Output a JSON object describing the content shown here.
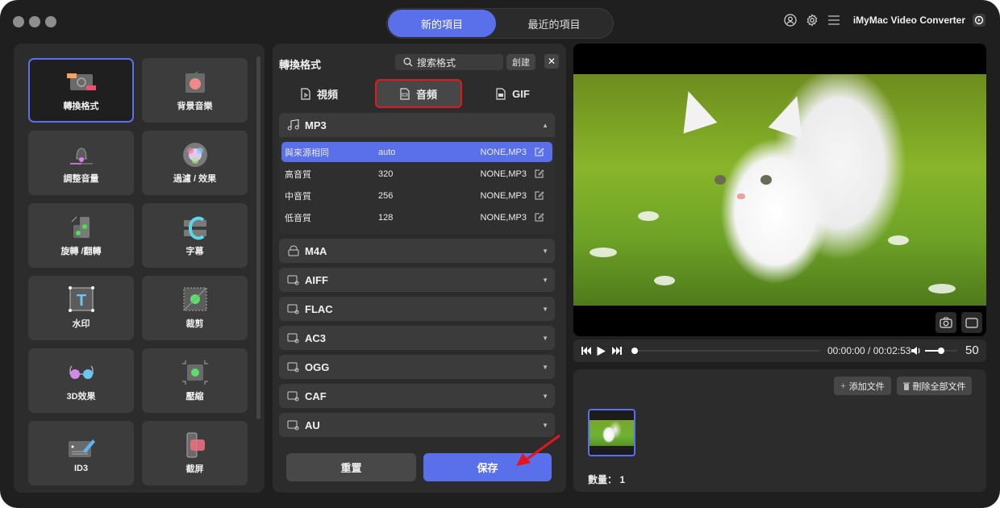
{
  "header": {
    "tabs": [
      {
        "label": "新的項目",
        "active": true
      },
      {
        "label": "最近的項目",
        "active": false
      }
    ],
    "icons": [
      "user-icon",
      "gear-icon",
      "menu-icon"
    ],
    "app_name": "iMyMac Video Converter"
  },
  "tools": [
    {
      "label": "轉換格式",
      "icon": "convert-format-icon",
      "active": true
    },
    {
      "label": "背景音樂",
      "icon": "background-music-icon",
      "active": false
    },
    {
      "label": "調整音量",
      "icon": "volume-adjust-icon",
      "active": false
    },
    {
      "label": "過濾 / 效果",
      "icon": "filter-effect-icon",
      "active": false
    },
    {
      "label": "旋轉 /翻轉",
      "icon": "rotate-flip-icon",
      "active": false
    },
    {
      "label": "字幕",
      "icon": "subtitle-icon",
      "active": false
    },
    {
      "label": "水印",
      "icon": "watermark-icon",
      "active": false
    },
    {
      "label": "裁剪",
      "icon": "crop-icon",
      "active": false
    },
    {
      "label": "3D效果",
      "icon": "3d-glasses-icon",
      "active": false
    },
    {
      "label": "壓縮",
      "icon": "compress-icon",
      "active": false
    },
    {
      "label": "ID3",
      "icon": "id3-edit-icon",
      "active": false
    },
    {
      "label": "截屏",
      "icon": "screenshot-icon",
      "active": false
    }
  ],
  "format_panel": {
    "title": "轉換格式",
    "search_placeholder": "搜索格式",
    "create_label": "創建",
    "close_label": "✕",
    "tabs": [
      {
        "label": "視頻",
        "icon": "video-file-icon",
        "active": false
      },
      {
        "label": "音頻",
        "icon": "audio-file-icon",
        "active": true
      },
      {
        "label": "GIF",
        "icon": "gif-file-icon",
        "active": false
      }
    ],
    "groups": [
      {
        "name": "MP3",
        "expanded": true,
        "rows": [
          {
            "quality": "與來源相同",
            "bitrate": "auto",
            "codec": "NONE,MP3",
            "selected": true
          },
          {
            "quality": "高音質",
            "bitrate": "320",
            "codec": "NONE,MP3",
            "selected": false
          },
          {
            "quality": "中音質",
            "bitrate": "256",
            "codec": "NONE,MP3",
            "selected": false
          },
          {
            "quality": "低音質",
            "bitrate": "128",
            "codec": "NONE,MP3",
            "selected": false
          }
        ]
      },
      {
        "name": "M4A",
        "expanded": false
      },
      {
        "name": "AIFF",
        "expanded": false
      },
      {
        "name": "FLAC",
        "expanded": false
      },
      {
        "name": "AC3",
        "expanded": false
      },
      {
        "name": "OGG",
        "expanded": false
      },
      {
        "name": "CAF",
        "expanded": false
      },
      {
        "name": "AU",
        "expanded": false
      }
    ],
    "reset_label": "重置",
    "save_label": "保存"
  },
  "player": {
    "current_time": "00:00:00",
    "total_time": "00:02:53",
    "time_display": "00:00:00 / 00:02:53",
    "progress_fraction": 0.0,
    "volume": "50",
    "volume_fraction": 0.5
  },
  "files": {
    "add_label": "添加文件",
    "delete_all_label": "刪除全部文件",
    "count_label": "數量：",
    "count_value": "1"
  },
  "colors": {
    "accent": "#5a6fea",
    "highlight_border": "#e01a1a",
    "background": "#1f1f1f",
    "panel": "#2c2c2c"
  }
}
